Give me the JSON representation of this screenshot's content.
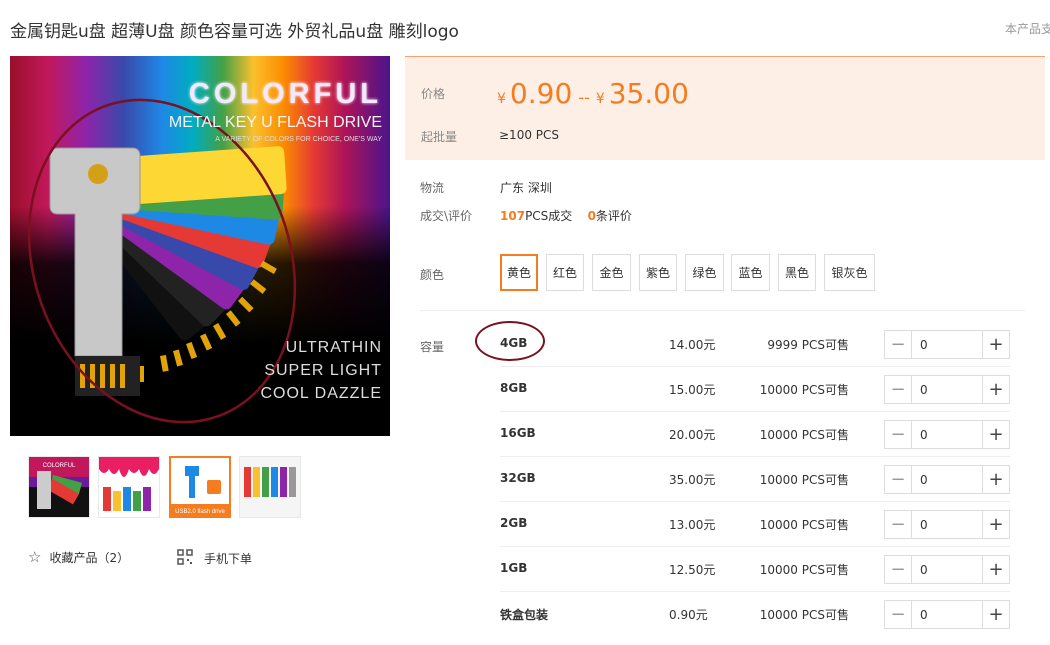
{
  "product": {
    "title": "金属钥匙u盘 超薄U盘 颜色容量可选 外贸礼品u盘 雕刻logo",
    "side_note": "本产品支"
  },
  "hero": {
    "line1": "COLORFUL",
    "line2": "METAL KEY  U FLASH DRIVE",
    "line3": "A VARIETY OF COLORS FOR CHOICE, ONE'S WAY",
    "line4": "ULTRATHIN",
    "line5": "SUPER LIGHT",
    "line6": "COOL DAZZLE"
  },
  "thumbs": [
    {
      "name": "thumb-colorful-keys",
      "active": false,
      "banner": "COLORFUL"
    },
    {
      "name": "thumb-paint-drips",
      "active": false
    },
    {
      "name": "thumb-usb-key",
      "active": true,
      "caption": "USB2.0 flash drive"
    },
    {
      "name": "thumb-color-row",
      "active": false
    }
  ],
  "actions": {
    "favorite_label": "收藏产品（2）",
    "mobile_label": "手机下单"
  },
  "price": {
    "label": "价格",
    "currency": "¥",
    "min": "0.90",
    "separator": "--",
    "max": "35.00",
    "moq_label": "起批量",
    "moq_value": "≥100  PCS"
  },
  "logistics": {
    "label": "物流",
    "value": "广东 深圳"
  },
  "deals": {
    "label": "成交\\评价",
    "count": "107",
    "count_unit": "PCS成交",
    "reviews": "0",
    "reviews_unit": "条评价"
  },
  "colors": {
    "label": "颜色",
    "options": [
      "黄色",
      "红色",
      "金色",
      "紫色",
      "绿色",
      "蓝色",
      "黑色",
      "银灰色"
    ],
    "selected": "黄色"
  },
  "capacity": {
    "label": "容量",
    "rows": [
      {
        "name": "4GB",
        "price": "14.00元",
        "stock": "9999 PCS可售",
        "qty": "0"
      },
      {
        "name": "8GB",
        "price": "15.00元",
        "stock": "10000 PCS可售",
        "qty": "0"
      },
      {
        "name": "16GB",
        "price": "20.00元",
        "stock": "10000 PCS可售",
        "qty": "0"
      },
      {
        "name": "32GB",
        "price": "35.00元",
        "stock": "10000 PCS可售",
        "qty": "0"
      },
      {
        "name": "2GB",
        "price": "13.00元",
        "stock": "10000 PCS可售",
        "qty": "0"
      },
      {
        "name": "1GB",
        "price": "12.50元",
        "stock": "10000 PCS可售",
        "qty": "0"
      },
      {
        "name": "铁盒包装",
        "price": "0.90元",
        "stock": "10000 PCS可售",
        "qty": "0"
      }
    ]
  },
  "theme": {
    "accent": "#f57c1f",
    "price_bg": "#fdefe5",
    "annotation": "#7a1020"
  }
}
